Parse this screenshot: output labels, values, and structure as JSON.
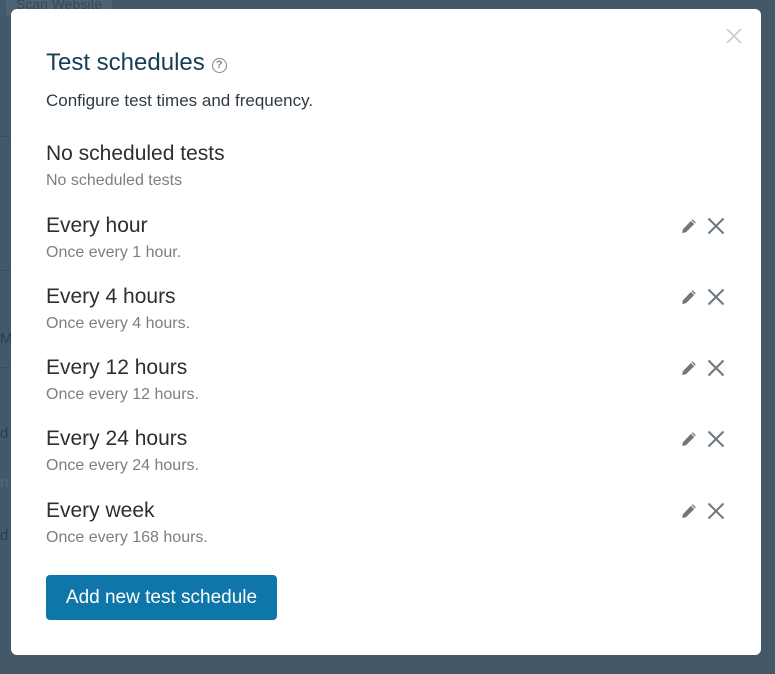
{
  "background": {
    "button_label": "Scan Website",
    "letters": [
      "M",
      "d",
      "n",
      "d"
    ]
  },
  "modal": {
    "title": "Test schedules",
    "help_icon": "question-circle-icon",
    "subtitle": "Configure test times and frequency.",
    "close_icon": "close-icon",
    "empty_item": {
      "name": "No scheduled tests",
      "description": "No scheduled tests"
    },
    "schedules": [
      {
        "name": "Every hour",
        "description": "Once every 1 hour."
      },
      {
        "name": "Every 4 hours",
        "description": "Once every 4 hours."
      },
      {
        "name": "Every 12 hours",
        "description": "Once every 12 hours."
      },
      {
        "name": "Every 24 hours",
        "description": "Once every 24 hours."
      },
      {
        "name": "Every week",
        "description": "Once every 168 hours."
      }
    ],
    "add_button_label": "Add new test schedule",
    "colors": {
      "primary": "#0e76a8",
      "title": "#143d57",
      "icon": "#6b7782"
    }
  }
}
